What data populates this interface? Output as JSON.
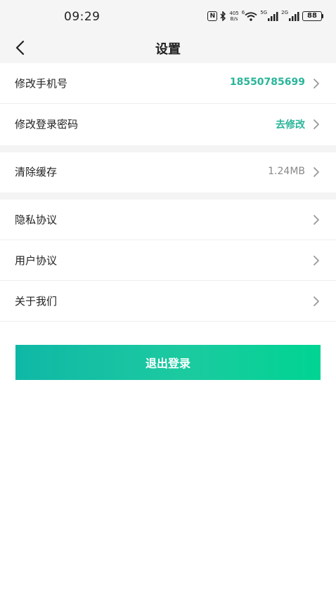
{
  "status_bar": {
    "time": "09:29",
    "nfc": "N",
    "speed_top": "405",
    "speed_bottom": "B/s",
    "wifi_sup": "6",
    "sig1_sup": "5G",
    "sig2_sup": "2G",
    "battery": "88"
  },
  "header": {
    "title": "设置"
  },
  "settings": {
    "group1": [
      {
        "label": "修改手机号",
        "value": "18550785699"
      },
      {
        "label": "修改登录密码",
        "value": "去修改"
      }
    ],
    "group2": [
      {
        "label": "清除缓存",
        "value": "1.24MB"
      }
    ],
    "group3": [
      {
        "label": "隐私协议"
      },
      {
        "label": "用户协议"
      },
      {
        "label": "关于我们"
      }
    ]
  },
  "logout": {
    "label": "退出登录"
  },
  "colors": {
    "accent": "#2ab59a",
    "gradient_start": "#0fb8a6",
    "gradient_end": "#00d493",
    "muted_text": "#888888",
    "section_gap": "#f4f4f4"
  }
}
